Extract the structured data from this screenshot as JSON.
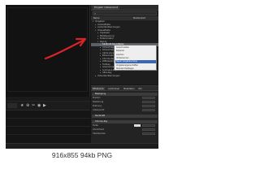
{
  "project": {
    "tabs": [
      "Projekt: Unbenannt"
    ],
    "search_placeholder": "",
    "columns": [
      "Name",
      "Medienstart"
    ],
    "tree": [
      {
        "label": "Vorgaben",
        "expanded": true
      },
      {
        "label": "Audioeffekte",
        "expanded": false
      },
      {
        "label": "Audioüberblendungen",
        "expanded": false
      },
      {
        "label": "Videoeffekte",
        "expanded": true
      },
      {
        "label": "Anpassen",
        "expanded": false
      },
      {
        "label": "Bildsteuerung",
        "expanded": false
      },
      {
        "label": "Farbkorrektur",
        "expanded": false
      },
      {
        "label": "Keying",
        "expanded": true
      },
      {
        "label": "16-Punkt-Spur-Maske",
        "expanded": false,
        "selected": true
      },
      {
        "label": "4-Punkt-Spur-Maske",
        "expanded": false
      },
      {
        "label": "8-Punkt-Spur-Maske",
        "expanded": false
      },
      {
        "label": "Alpha-Anpassung",
        "expanded": false
      },
      {
        "label": "Bluescreen-Key",
        "expanded": false
      },
      {
        "label": "Chroma-Key",
        "expanded": false
      },
      {
        "label": "Differenzmaske",
        "expanded": false
      },
      {
        "label": "Farbkey",
        "expanded": false
      },
      {
        "label": "Greenscreen-Key",
        "expanded": false
      },
      {
        "label": "Luminanz-Key",
        "expanded": false
      },
      {
        "label": "Ultra-Key",
        "expanded": false
      },
      {
        "label": "Videoüberblendungen",
        "expanded": false
      }
    ]
  },
  "context_menu": {
    "items": [
      "Ausschneiden",
      "Kopieren",
      "Löschen",
      "Umbenennen",
      "Neuer Vorgabenordner",
      "Vorgabeneigenschaften",
      "Standard festlegen"
    ],
    "hover_index": 4
  },
  "timeline": {
    "icons": [
      "★",
      "⊕",
      "✂",
      "◉",
      "▶"
    ]
  },
  "effects": {
    "tabs": [
      "Effekteinst.",
      "Audiomixer",
      "Metadaten",
      "Info"
    ],
    "active_tab": 0,
    "sections": [
      "Bewegung",
      "Deckkraft",
      "Chroma-Key"
    ],
    "rows": [
      "Position",
      "Skalierung",
      "Drehung",
      "Ankerpunkt",
      "Farbe",
      "Ähnlichkeit",
      "Überblenden"
    ]
  },
  "caption": "916x855 94kb PNG",
  "colors": {
    "annotation": "#d8232a",
    "selection": "#5b5f66",
    "menu_hover": "#3c68b0"
  }
}
